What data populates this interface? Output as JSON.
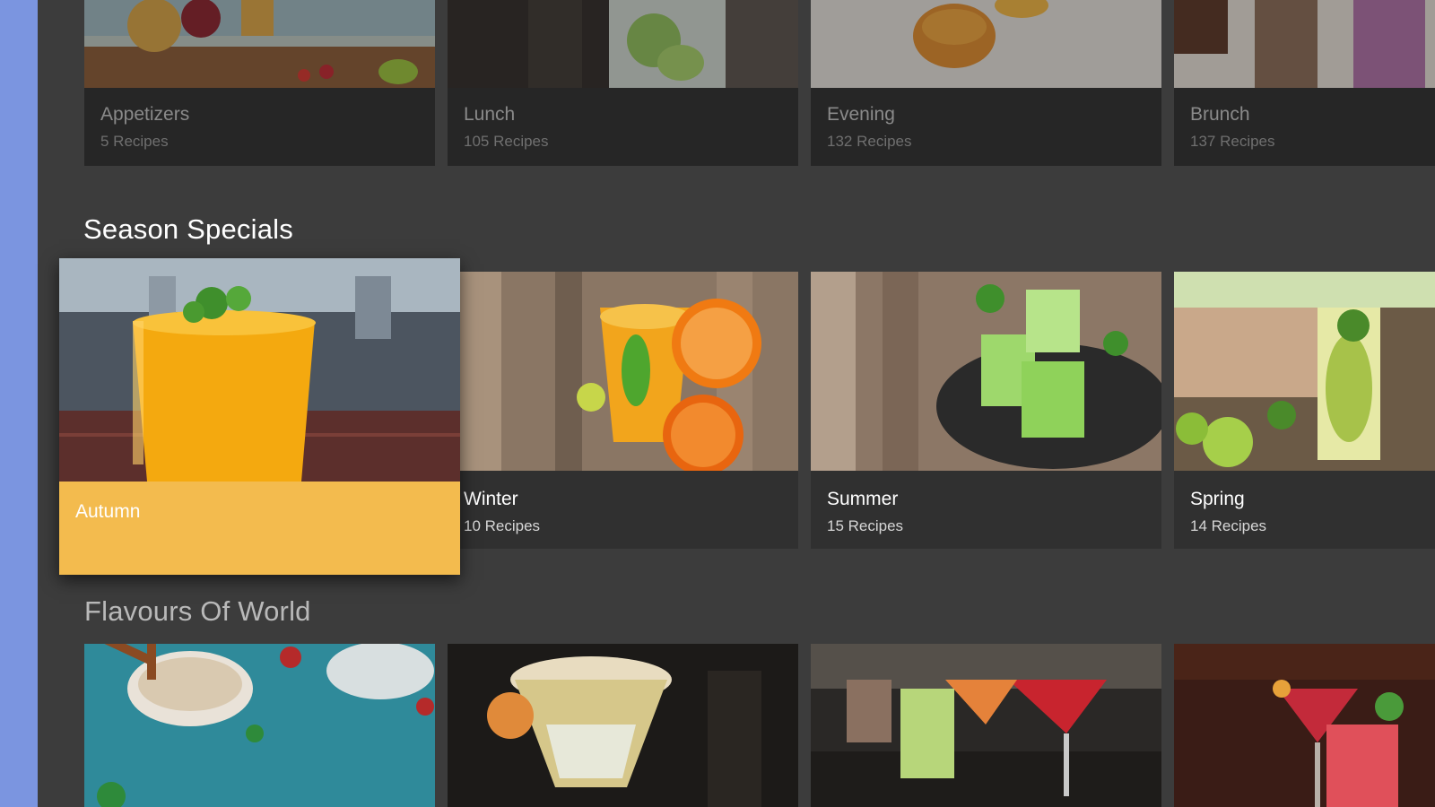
{
  "meal_row": {
    "cards": [
      {
        "name": "Appetizers",
        "count": "5 Recipes"
      },
      {
        "name": "Lunch",
        "count": "105 Recipes"
      },
      {
        "name": "Evening",
        "count": "132 Recipes"
      },
      {
        "name": "Brunch",
        "count": "137 Recipes"
      }
    ]
  },
  "season_row": {
    "title": "Season Specials",
    "cards": [
      {
        "name": "Autumn",
        "count": ""
      },
      {
        "name": "Winter",
        "count": "10 Recipes"
      },
      {
        "name": "Summer",
        "count": "15 Recipes"
      },
      {
        "name": "Spring",
        "count": "14 Recipes"
      }
    ]
  },
  "world_row": {
    "title": "Flavours Of World"
  },
  "colors": {
    "side_accent": "#7b95e0",
    "background": "#3c3c3c",
    "focus_accent": "#f3bb4e"
  },
  "icons": []
}
